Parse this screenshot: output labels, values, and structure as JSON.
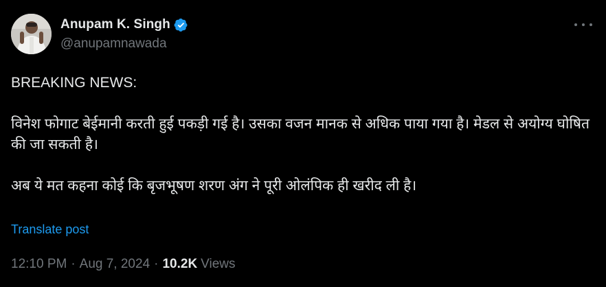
{
  "author": {
    "display_name": "Anupam K. Singh",
    "handle": "@anupamnawada",
    "verified": true,
    "verified_color": "#1d9bf0"
  },
  "more_icon": "more-horizontal-icon",
  "post": {
    "lines": [
      "BREAKING NEWS:",
      "विनेश फोगाट बेईमानी करती हुई पकड़ी गई है। उसका वजन मानक से अधिक पाया गया है। मेडल से अयोग्य घोषित की जा सकती है।",
      "अब ये मत कहना कोई कि बृजभूषण शरण अंग ने पूरी ओलंपिक ही खरीद ली है।"
    ]
  },
  "translate_label": "Translate post",
  "meta": {
    "time": "12:10 PM",
    "separator": "·",
    "date": "Aug 7, 2024",
    "views_count": "10.2K",
    "views_label": "Views"
  },
  "colors": {
    "background": "#000000",
    "text": "#e7e9ea",
    "secondary": "#71767b",
    "link": "#1d9bf0"
  }
}
